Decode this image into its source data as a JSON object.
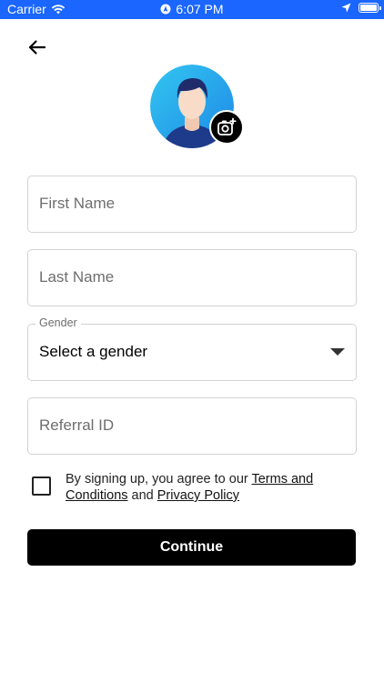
{
  "status_bar": {
    "carrier": "Carrier",
    "time": "6:07 PM",
    "icons": [
      "wifi-icon",
      "location-indicator-icon",
      "location-arrow-icon",
      "battery-icon"
    ],
    "background": "#1a66ff"
  },
  "header": {
    "back_icon": "arrow-left-icon"
  },
  "avatar": {
    "icon": "person-avatar-icon",
    "camera_icon": "add-photo-icon"
  },
  "form": {
    "first_name": {
      "placeholder": "First Name",
      "value": ""
    },
    "last_name": {
      "placeholder": "Last Name",
      "value": ""
    },
    "gender": {
      "label": "Gender",
      "selected": "Select a gender"
    },
    "referral": {
      "placeholder": "Referral ID",
      "value": ""
    }
  },
  "terms": {
    "prefix": "By signing up, you agree to our ",
    "terms_link": "Terms and Conditions",
    "and": " and ",
    "privacy_link": "Privacy Policy",
    "checked": false
  },
  "continue": {
    "label": "Continue"
  }
}
